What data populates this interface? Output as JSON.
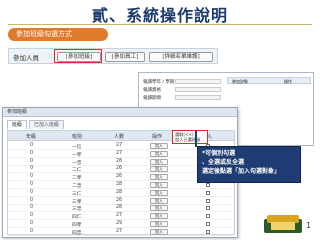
{
  "slide": {
    "title": "貳、系統操作說明",
    "page_number": "1"
  },
  "section": {
    "label": "參加班級勾選方式"
  },
  "form": {
    "label": "參加人員",
    "buttons": [
      "[參加班級]",
      "[參加員工]",
      "[詳細名單維護]"
    ]
  },
  "overlay": {
    "rows": [
      "報讀學年 / 學期",
      "報讀資格",
      "報讀期間"
    ],
    "table_headers": [
      "參加對象",
      "操作"
    ]
  },
  "window": {
    "title": "參加班級",
    "tabs": [
      "班級",
      "已加入班級"
    ],
    "columns": [
      "年級",
      "班別",
      "人數",
      "操作",
      "加入"
    ],
    "header_action": {
      "line1": "選取(<<)",
      "line2": "加入已選班級"
    },
    "add_button": "加入",
    "rows": [
      {
        "grade": "0",
        "class": "一信",
        "count": "27"
      },
      {
        "grade": "0",
        "class": "一孝",
        "count": "27"
      },
      {
        "grade": "0",
        "class": "一忠",
        "count": "28"
      },
      {
        "grade": "0",
        "class": "二仁",
        "count": "26"
      },
      {
        "grade": "0",
        "class": "二孝",
        "count": "26"
      },
      {
        "grade": "0",
        "class": "二忠",
        "count": "28"
      },
      {
        "grade": "0",
        "class": "三仁",
        "count": "28"
      },
      {
        "grade": "0",
        "class": "三孝",
        "count": "26"
      },
      {
        "grade": "0",
        "class": "三忠",
        "count": "28"
      },
      {
        "grade": "0",
        "class": "四仁",
        "count": "27"
      },
      {
        "grade": "0",
        "class": "四孝",
        "count": "29"
      },
      {
        "grade": "0",
        "class": "四忠",
        "count": "27"
      }
    ]
  },
  "callout": {
    "lines": [
      "*可個別勾選",
      "、全選或反全選",
      "選定後點選「加入勾選對象」"
    ]
  },
  "colors": {
    "title": "#1a3a6e",
    "pill": "#e07a2d",
    "highlight": "#e02a2a",
    "callout_bg": "#1f3c73"
  }
}
